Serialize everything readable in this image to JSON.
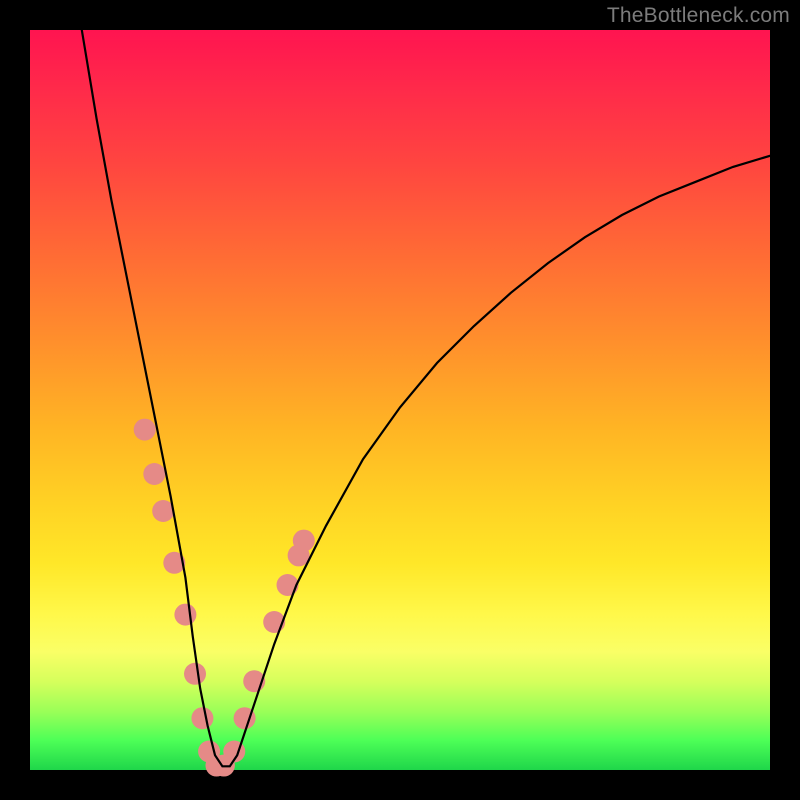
{
  "watermark": "TheBottleneck.com",
  "chart_data": {
    "type": "line",
    "title": "",
    "xlabel": "",
    "ylabel": "",
    "xlim": [
      0,
      100
    ],
    "ylim": [
      0,
      100
    ],
    "note": "Axes are unlabeled; x spans the plot width, y=0 at bottom (green) and y=100 at top (red). The curve shows a bottleneck-style dip reaching ~0 near x≈24.",
    "series": [
      {
        "name": "bottleneck-curve",
        "x": [
          7,
          9,
          11,
          13,
          15,
          17,
          19,
          21,
          22,
          23,
          24,
          25,
          26,
          27,
          28,
          30,
          33,
          36,
          40,
          45,
          50,
          55,
          60,
          65,
          70,
          75,
          80,
          85,
          90,
          95,
          100
        ],
        "values": [
          100,
          88,
          77,
          67,
          57,
          47,
          37,
          26,
          18,
          11,
          6,
          2,
          0.5,
          0.5,
          2,
          8,
          17,
          25,
          33,
          42,
          49,
          55,
          60,
          64.5,
          68.5,
          72,
          75,
          77.5,
          79.5,
          81.5,
          83
        ]
      }
    ],
    "markers": {
      "name": "highlight-dots",
      "color": "#e58a87",
      "radius_px": 11,
      "points_xy": [
        [
          15.5,
          46
        ],
        [
          16.8,
          40
        ],
        [
          18.0,
          35
        ],
        [
          19.5,
          28
        ],
        [
          21.0,
          21
        ],
        [
          22.3,
          13
        ],
        [
          23.3,
          7
        ],
        [
          24.2,
          2.5
        ],
        [
          25.2,
          0.6
        ],
        [
          26.2,
          0.6
        ],
        [
          27.6,
          2.5
        ],
        [
          29.0,
          7
        ],
        [
          30.3,
          12
        ],
        [
          33.0,
          20
        ],
        [
          34.8,
          25
        ],
        [
          36.3,
          29
        ],
        [
          37.0,
          31
        ]
      ]
    }
  }
}
